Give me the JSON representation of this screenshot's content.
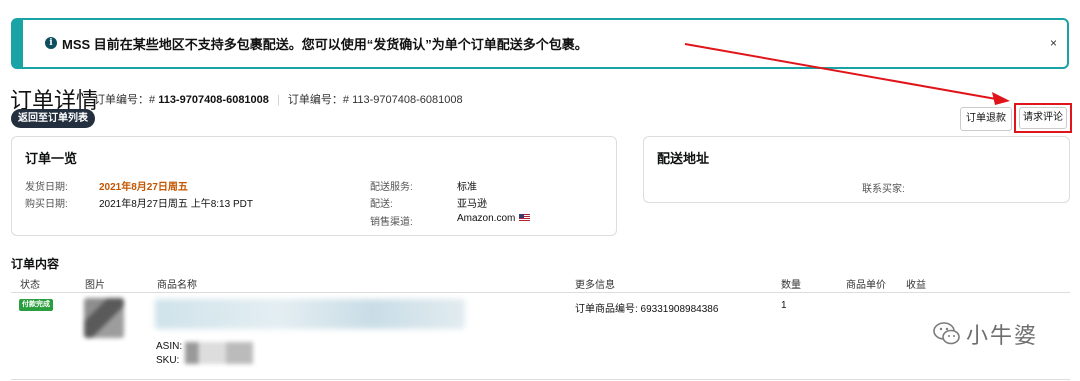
{
  "alert": {
    "message": "MSS 目前在某些地区不支持多包裹配送。您可以使用“发货确认”为单个订单配送多个包裹。",
    "info_icon": "i",
    "close": "×"
  },
  "header": {
    "title": "订单详情",
    "order_id_label_1": "订单编号：#",
    "order_id_value_1": "113-9707408-6081008",
    "order_id_label_2": "订单编号：#",
    "order_id_value_2": "113-9707408-6081008",
    "back_button": "返回至订单列表",
    "refund_button": "订单退款",
    "review_button": "请求评论"
  },
  "summary": {
    "title": "订单一览",
    "ship_date_label": "发货日期:",
    "ship_date_value": "2021年8月27日周五",
    "purchase_date_label": "购买日期:",
    "purchase_date_value": "2021年8月27日周五 上午8:13 PDT",
    "shipping_service_label": "配送服务:",
    "shipping_service_value": "标准",
    "fulfillment_label": "配送:",
    "fulfillment_value": "亚马逊",
    "sales_channel_label": "销售渠道:",
    "sales_channel_value": "Amazon.com"
  },
  "shipping_address": {
    "title": "配送地址",
    "contact_label": "联系买家:"
  },
  "order_content": {
    "title": "订单内容",
    "columns": [
      "状态",
      "图片",
      "商品名称",
      "更多信息",
      "数量",
      "商品单价",
      "收益"
    ],
    "rows": [
      {
        "status": "付款完成",
        "asin_label": "ASIN:",
        "sku_label": "SKU:",
        "more_info": "订单商品编号: 69331908984386",
        "quantity": "1"
      }
    ]
  },
  "watermark": {
    "text": "小牛婆"
  },
  "colors": {
    "accent": "#1aa3a5",
    "highlight": "#c45500",
    "annotation": "#e0151b",
    "status_green": "#2a9e3e"
  },
  "icons": {
    "alert": "info-icon",
    "close": "close-icon",
    "flag": "us-flag-icon",
    "watermark": "wechat-icon"
  }
}
